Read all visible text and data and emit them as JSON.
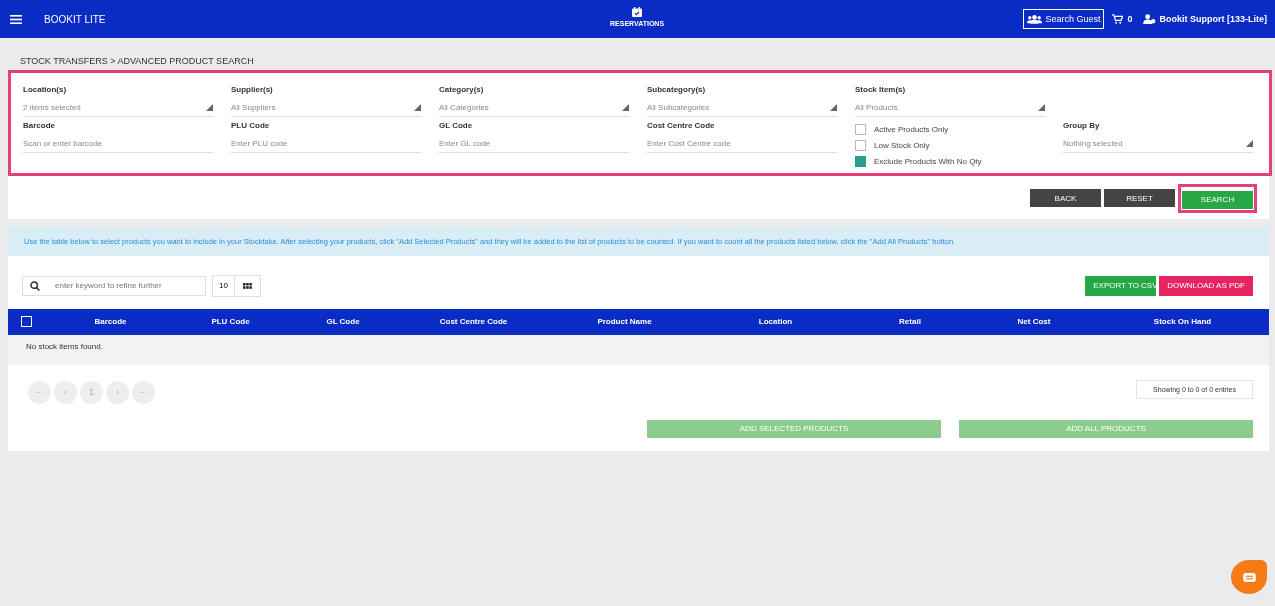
{
  "header": {
    "brand": "BOOKIT LITE",
    "center_label": "RESERVATIONS",
    "search_guest": "Search Guest",
    "cart_count": "0",
    "user": "Bookit Support [133-Lite]"
  },
  "breadcrumb": "STOCK TRANSFERS > ADVANCED PRODUCT SEARCH",
  "filter_rows": [
    [
      {
        "kind": "select",
        "label": "Location(s)",
        "value": "2 items selected"
      },
      {
        "kind": "select",
        "label": "Supplier(s)",
        "value": "All Suppliers"
      },
      {
        "kind": "select",
        "label": "Category(s)",
        "value": "All Categories"
      },
      {
        "kind": "select",
        "label": "Subcategory(s)",
        "value": "All Subcategories"
      },
      {
        "kind": "select",
        "label": "Stock Item(s)",
        "value": "All Products"
      }
    ],
    [
      {
        "kind": "text",
        "label": "Barcode",
        "placeholder": "Scan or enter barcode"
      },
      {
        "kind": "text",
        "label": "PLU Code",
        "placeholder": "Enter PLU code"
      },
      {
        "kind": "text",
        "label": "GL Code",
        "placeholder": "Enter GL code"
      },
      {
        "kind": "text",
        "label": "Cost Centre Code",
        "placeholder": "Enter Cost Centre code"
      },
      {
        "kind": "checks",
        "items": [
          {
            "label": "Active Products Only",
            "checked": false
          },
          {
            "label": "Low Stock Only",
            "checked": false
          },
          {
            "label": "Exclude Products With No Qty",
            "checked": true
          }
        ]
      },
      {
        "kind": "select",
        "label": "Group By",
        "value": "Nothing selected"
      }
    ]
  ],
  "actions": [
    {
      "label": "BACK",
      "kind": "dark"
    },
    {
      "label": "RESET",
      "kind": "dark"
    },
    {
      "label": "SEARCH",
      "kind": "green"
    }
  ],
  "info": "Use the table below to select products you want to include in your Stocktake. After selecting your products, click \"Add Selected Products\" and they will be added to the list of products to be counted. If you want to count all the products listed below, click the \"Add All Products\" button.",
  "table_tools": {
    "search_placeholder": "enter keyword to refine further",
    "page_size": "10",
    "exports": [
      {
        "label": "EXPORT TO CSV",
        "kind": "green"
      },
      {
        "label": "DOWNLOAD AS PDF",
        "kind": "pink"
      }
    ]
  },
  "table": {
    "select_all_checked": false,
    "columns": [
      "Barcode",
      "PLU Code",
      "GL Code",
      "Cost Centre Code",
      "Product Name",
      "Location",
      "Retail",
      "Net Cost",
      "Stock On Hand"
    ],
    "empty_message": "No stock items found."
  },
  "pagination": [
    "···",
    "‹",
    "1",
    "›",
    "···"
  ],
  "entries": "Showing 0 to 0 of 0 entries",
  "bottom_buttons": [
    {
      "label": "ADD SELECTED PRODUCTS",
      "disabled": true
    },
    {
      "label": "ADD ALL PRODUCTS",
      "disabled": true
    }
  ]
}
